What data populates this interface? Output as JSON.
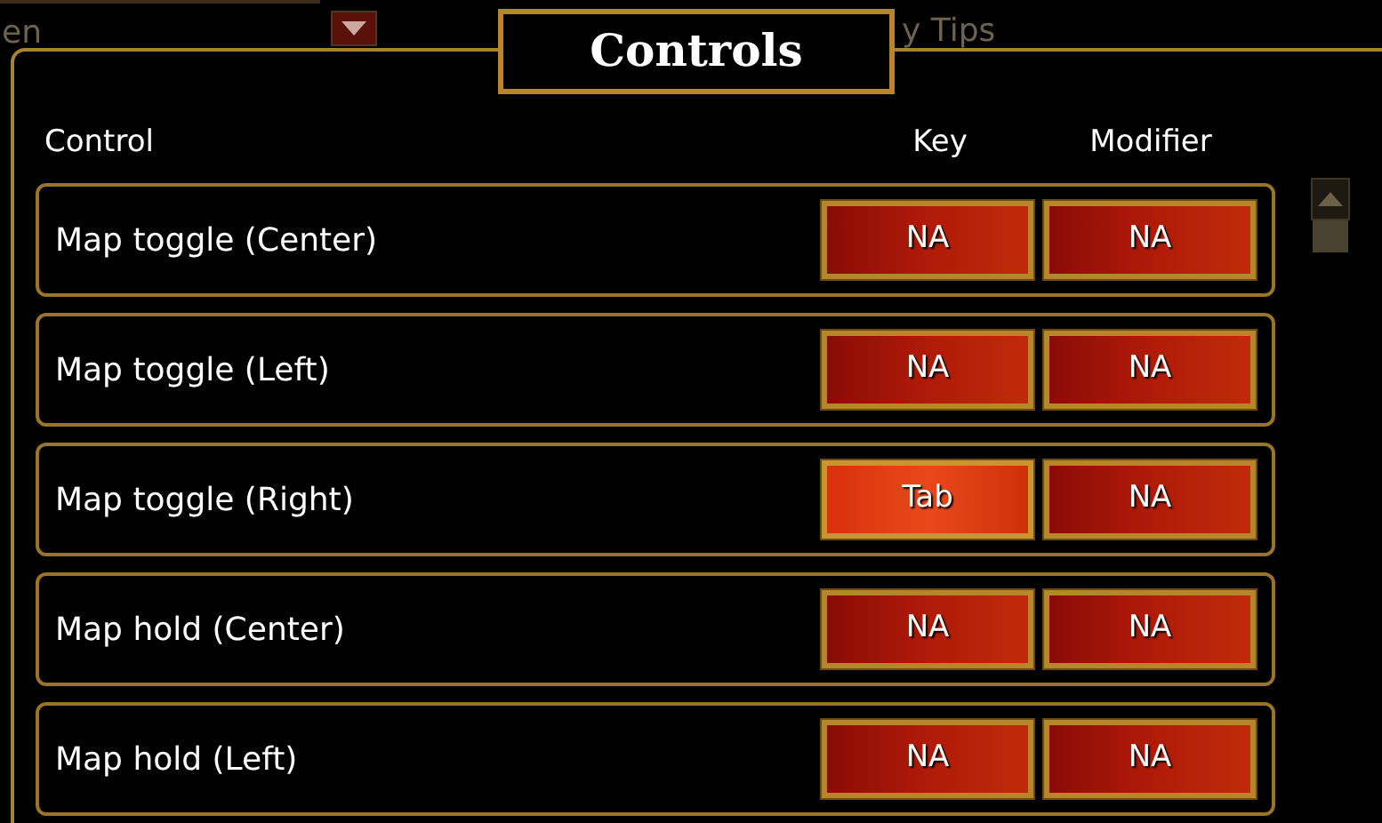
{
  "background": {
    "texts": [
      "en",
      "y Tips"
    ]
  },
  "dialog": {
    "title": "Controls"
  },
  "columns": {
    "control": "Control",
    "key": "Key",
    "modifier": "Modifier"
  },
  "rows": [
    {
      "control": "Map toggle (Center)",
      "key": {
        "label": "NA",
        "selected": false
      },
      "modifier": {
        "label": "NA",
        "selected": false
      }
    },
    {
      "control": "Map toggle (Left)",
      "key": {
        "label": "NA",
        "selected": false
      },
      "modifier": {
        "label": "NA",
        "selected": false
      }
    },
    {
      "control": "Map toggle (Right)",
      "key": {
        "label": "Tab",
        "selected": true
      },
      "modifier": {
        "label": "NA",
        "selected": false
      }
    },
    {
      "control": "Map hold (Center)",
      "key": {
        "label": "NA",
        "selected": false
      },
      "modifier": {
        "label": "NA",
        "selected": false
      }
    },
    {
      "control": "Map hold (Left)",
      "key": {
        "label": "NA",
        "selected": false
      },
      "modifier": {
        "label": "NA",
        "selected": false
      }
    }
  ]
}
